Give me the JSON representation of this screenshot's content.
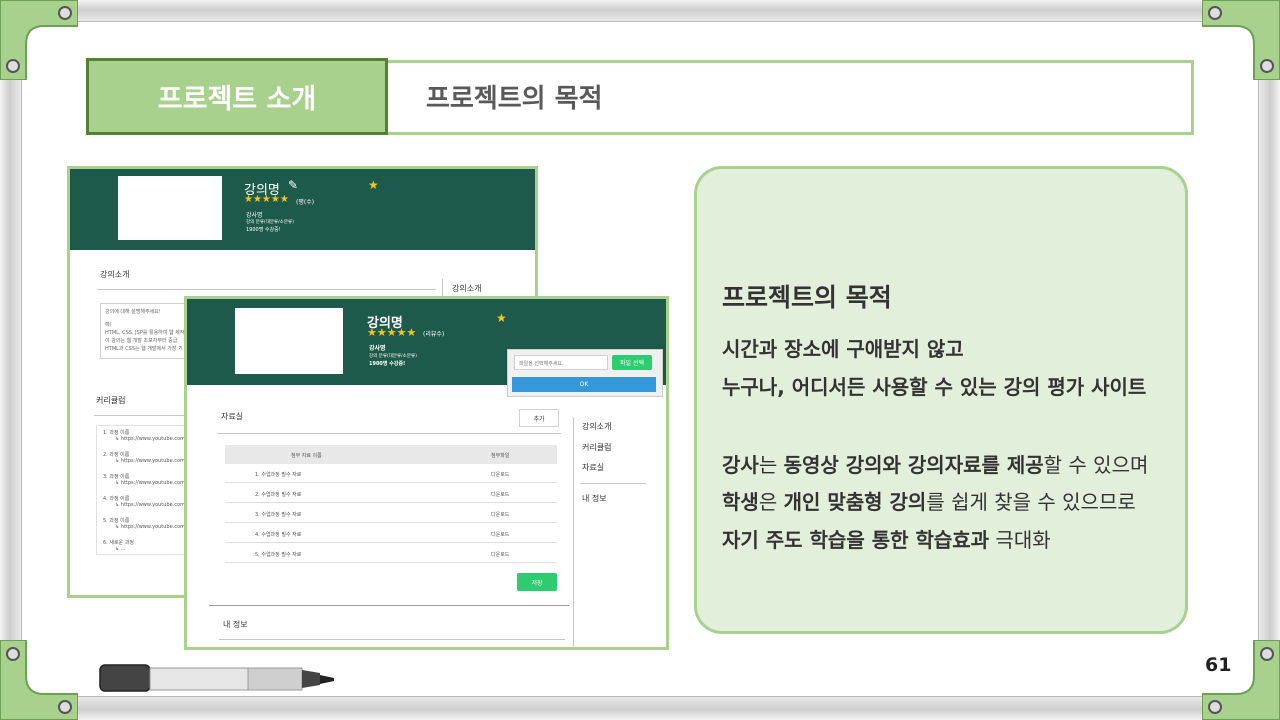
{
  "header": {
    "tab_label": "프로젝트 소개",
    "title": "프로젝트의 목적"
  },
  "mock_back": {
    "course_title": "강의명",
    "review_count": "(평(수)",
    "instructor": "강사명",
    "category": "강의 분류(대분류/소분류)",
    "students": "1900명 수강중!",
    "section_intro": "강의소개",
    "side_intro": "강의소개",
    "intro_placeholder": "강의에 대해 설명해주세요!",
    "intro_lines": [
      "예)",
      "HTML, CSS, JSP를 활용하여 웹 제작",
      "이 강의는 웹 개발 초보자부터 중급",
      "HTML과 CSS는 웹 개발에서 가장 기"
    ],
    "curriculum_title": "커리큘럼",
    "curriculum": [
      {
        "name": "1. 과정 이름",
        "link": "↳ https://www.youtube.com"
      },
      {
        "name": "2. 과정 이름",
        "link": "↳ https://www.youtube.com"
      },
      {
        "name": "3. 과정 이름",
        "link": "↳ https://www.youtube.com"
      },
      {
        "name": "4. 과정 이름",
        "link": "↳ https://www.youtube.com"
      },
      {
        "name": "5. 과정 이름",
        "link": "↳ https://www.youtube.com"
      },
      {
        "name": "6. 새로운 과정",
        "link": "↳ ..."
      }
    ]
  },
  "mock_front": {
    "course_title": "강의명",
    "review_count": "(리뷰수)",
    "instructor": "강사명",
    "category": "강의 분류(대분류/소분류)",
    "students": "1900명 수강중!",
    "upload_placeholder": "파일을 선택해주세요.",
    "file_select_label": "파일 선택",
    "ok_label": "OK",
    "section_title": "자료실",
    "add_label": "추가",
    "col_name": "첨부 자료 이름",
    "col_file": "첨부파일",
    "rows": [
      {
        "name": "1. 수업과정 필수 자료",
        "file": "다운로드"
      },
      {
        "name": "2. 수업과정 필수 자료",
        "file": "다운로드"
      },
      {
        "name": "3. 수업과정 필수 자료",
        "file": "다운로드"
      },
      {
        "name": "4. 수업과정 필수 자료",
        "file": "다운로드"
      },
      {
        "name": "5. 수업과정 필수 자료",
        "file": "다운로드"
      }
    ],
    "save_label": "저장",
    "my_info": "내 정보",
    "side": [
      "강의소개",
      "커리큘럼",
      "자료실"
    ],
    "side_my_info": "내 정보"
  },
  "card": {
    "title": "프로젝트의 목적",
    "line1": "시간과 장소에 구애받지 않고",
    "line2": "누구나, 어디서든 사용할 수 있는 강의 평가 사이트",
    "p1_a": "강사",
    "p1_b": "는 ",
    "p1_c": "동영상 강의와 강의자료를 제공",
    "p1_d": "할 수 있으며",
    "p2_a": "학생",
    "p2_b": "은 ",
    "p2_c": "개인 맞춤형 강의",
    "p2_d": "를 쉽게 찾을 수 있으므로",
    "p3_a": "자기 주도 학습을 통한 학습효과",
    "p3_b": " 극대화"
  },
  "page_number": "61",
  "colors": {
    "accent": "#a9d18e",
    "accent_dark": "#548235",
    "banner": "#1e5a4b",
    "card_bg": "#e2efda"
  }
}
